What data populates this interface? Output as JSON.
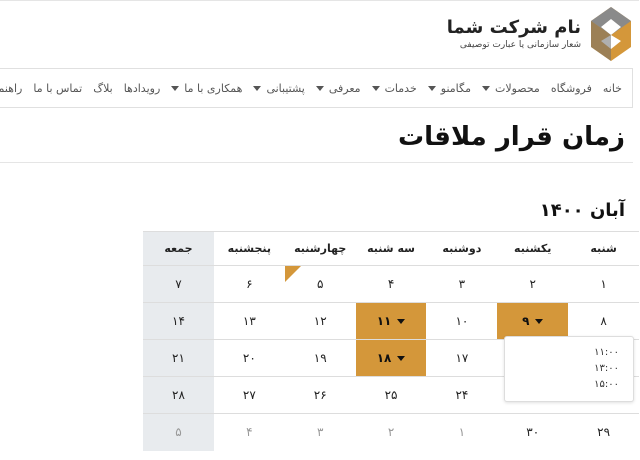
{
  "logo": {
    "title": "نام شرکت شما",
    "slogan": "شعار سازمانی یا عبارت توصیفی"
  },
  "nav": [
    {
      "label": "خانه",
      "dropdown": false
    },
    {
      "label": "فروشگاه",
      "dropdown": false
    },
    {
      "label": "محصولات",
      "dropdown": true
    },
    {
      "label": "مگامنو",
      "dropdown": true
    },
    {
      "label": "خدمات",
      "dropdown": true
    },
    {
      "label": "معرفی",
      "dropdown": true
    },
    {
      "label": "پشتیبانی",
      "dropdown": true
    },
    {
      "label": "همکاری با ما",
      "dropdown": true
    },
    {
      "label": "رویدادها",
      "dropdown": false
    },
    {
      "label": "بلاگ",
      "dropdown": false
    },
    {
      "label": "تماس با ما",
      "dropdown": false
    },
    {
      "label": "راهنما",
      "dropdown": false
    }
  ],
  "page_title": "زمان قرار ملاقات",
  "month_title": "آبان ۱۴۰۰",
  "weekdays": [
    "شنبه",
    "یکشنبه",
    "دوشنبه",
    "سه شنبه",
    "چهارشنبه",
    "پنجشنبه",
    "جمعه"
  ],
  "weeks": [
    [
      "۱",
      "۲",
      "۳",
      "۴",
      "۵",
      "۶",
      "۷"
    ],
    [
      "۸",
      "۹",
      "۱۰",
      "۱۱",
      "۱۲",
      "۱۳",
      "۱۴"
    ],
    [
      "",
      "",
      "۱۷",
      "۱۸",
      "۱۹",
      "۲۰",
      "۲۱"
    ],
    [
      "",
      "",
      "۲۴",
      "۲۵",
      "۲۶",
      "۲۷",
      "۲۸"
    ],
    [
      "۲۹",
      "۳۰",
      "۱",
      "۲",
      "۳",
      "۴",
      "۵"
    ]
  ],
  "times": [
    "۱۱:۰۰",
    "۱۳:۰۰",
    "۱۵:۰۰"
  ],
  "colors": {
    "accent": "#d4973a",
    "friday_bg": "#e8ebee"
  }
}
